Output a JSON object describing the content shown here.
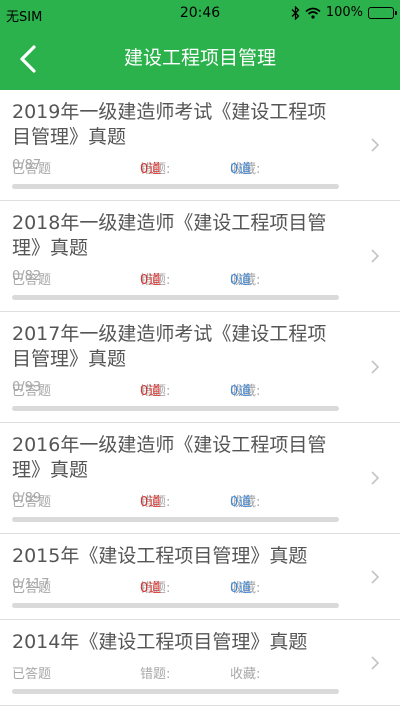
{
  "status_bar": {
    "carrier": "无SIM",
    "time": "20:46",
    "battery_text": "100%",
    "icons": [
      "bluetooth-icon",
      "wifi-icon",
      "battery-icon"
    ]
  },
  "nav": {
    "title": "建设工程项目管理",
    "back_icon": "chevron-left-icon"
  },
  "colors": {
    "primary": "#2bb24c",
    "wrong_value": "#d9302c",
    "favorite_value": "#3e86d6"
  },
  "items": [
    {
      "title": "2019年一级建造师考试《建设工程项目管理》真题",
      "answered_label": "已答题",
      "answered": "0/87",
      "wrong_label": "错题:",
      "wrong": "0道",
      "favorite_label": "收藏:",
      "favorite": "0道",
      "progress": 0
    },
    {
      "title": "2018年一级建造师《建设工程项目管理》真题",
      "answered_label": "已答题",
      "answered": "0/82",
      "wrong_label": "错题:",
      "wrong": "0道",
      "favorite_label": "收藏:",
      "favorite": "0道",
      "progress": 0
    },
    {
      "title": "2017年一级建造师考试《建设工程项目管理》真题",
      "answered_label": "已答题",
      "answered": "0/93",
      "wrong_label": "错题:",
      "wrong": "0道",
      "favorite_label": "收藏:",
      "favorite": "0道",
      "progress": 0
    },
    {
      "title": "2016年一级建造师《建设工程项目管理》真题",
      "answered_label": "已答题",
      "answered": "0/89",
      "wrong_label": "错题:",
      "wrong": "0道",
      "favorite_label": "收藏:",
      "favorite": "0道",
      "progress": 0
    },
    {
      "title": "2015年《建设工程项目管理》真题",
      "answered_label": "已答题",
      "answered": "0/117",
      "wrong_label": "错题:",
      "wrong": "0道",
      "favorite_label": "收藏:",
      "favorite": "0道",
      "progress": 0
    },
    {
      "title": "2014年《建设工程项目管理》真题",
      "answered_label": "已答题",
      "answered": "",
      "wrong_label": "错题:",
      "wrong": "",
      "favorite_label": "收藏:",
      "favorite": "",
      "progress": 0
    }
  ]
}
